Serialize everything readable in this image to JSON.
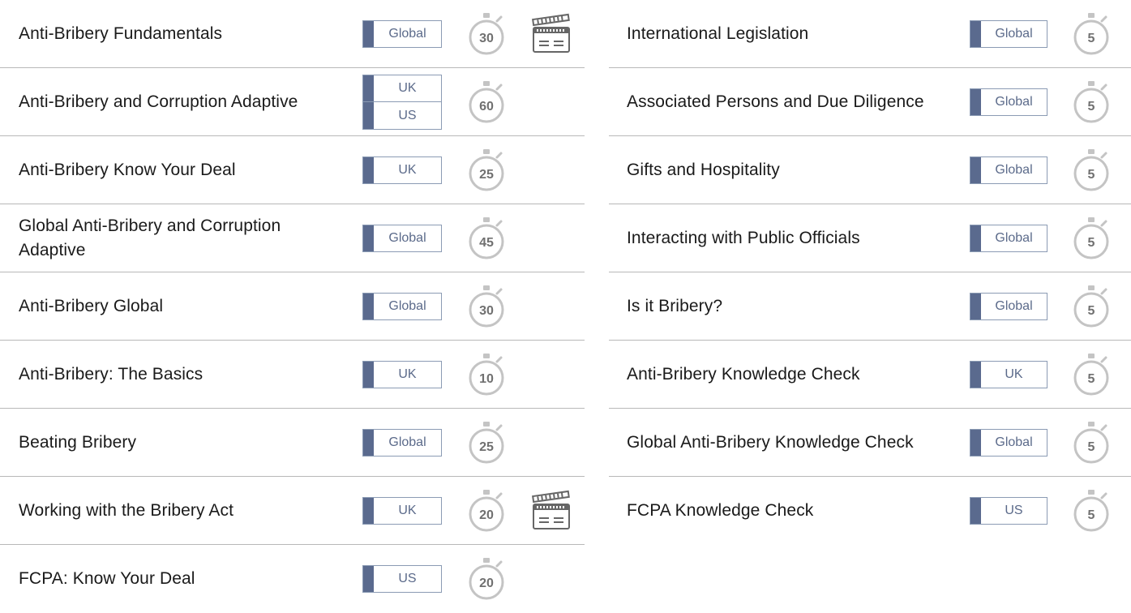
{
  "left_courses": [
    {
      "title": "Anti-Bribery Fundamentals",
      "tags": [
        "Global"
      ],
      "minutes": "30",
      "video": true
    },
    {
      "title": "Anti-Bribery and Corruption Adaptive",
      "tags": [
        "UK",
        "US"
      ],
      "minutes": "60",
      "video": false
    },
    {
      "title": "Anti-Bribery Know Your Deal",
      "tags": [
        "UK"
      ],
      "minutes": "25",
      "video": false
    },
    {
      "title": "Global Anti-Bribery and Corruption Adaptive",
      "tags": [
        "Global"
      ],
      "minutes": "45",
      "video": false
    },
    {
      "title": "Anti-Bribery Global",
      "tags": [
        "Global"
      ],
      "minutes": "30",
      "video": false
    },
    {
      "title": "Anti-Bribery: The Basics",
      "tags": [
        "UK"
      ],
      "minutes": "10",
      "video": false
    },
    {
      "title": "Beating Bribery",
      "tags": [
        "Global"
      ],
      "minutes": "25",
      "video": false
    },
    {
      "title": "Working with the Bribery Act",
      "tags": [
        "UK"
      ],
      "minutes": "20",
      "video": true
    },
    {
      "title": "FCPA: Know Your Deal",
      "tags": [
        "US"
      ],
      "minutes": "20",
      "video": false
    }
  ],
  "right_courses": [
    {
      "title": "International Legislation",
      "tags": [
        "Global"
      ],
      "minutes": "5",
      "video": false
    },
    {
      "title": "Associated Persons and Due Diligence",
      "tags": [
        "Global"
      ],
      "minutes": "5",
      "video": false
    },
    {
      "title": "Gifts and Hospitality",
      "tags": [
        "Global"
      ],
      "minutes": "5",
      "video": false
    },
    {
      "title": "Interacting with Public Officials",
      "tags": [
        "Global"
      ],
      "minutes": "5",
      "video": false
    },
    {
      "title": "Is it Bribery?",
      "tags": [
        "Global"
      ],
      "minutes": "5",
      "video": false
    },
    {
      "title": "Anti-Bribery Knowledge Check",
      "tags": [
        "UK"
      ],
      "minutes": "5",
      "video": false
    },
    {
      "title": "Global Anti-Bribery Knowledge Check",
      "tags": [
        "Global"
      ],
      "minutes": "5",
      "video": false
    },
    {
      "title": "FCPA Knowledge Check",
      "tags": [
        "US"
      ],
      "minutes": "5",
      "video": false
    }
  ],
  "icons": {
    "timer": "stopwatch-icon",
    "video": "clapperboard-icon"
  },
  "colors": {
    "tag_flag": "#5a6a8e",
    "tag_border": "#8b9bb4",
    "tag_text": "#5b6a8a",
    "divider": "#b8b8b8",
    "timer": "#c4c4c4"
  }
}
